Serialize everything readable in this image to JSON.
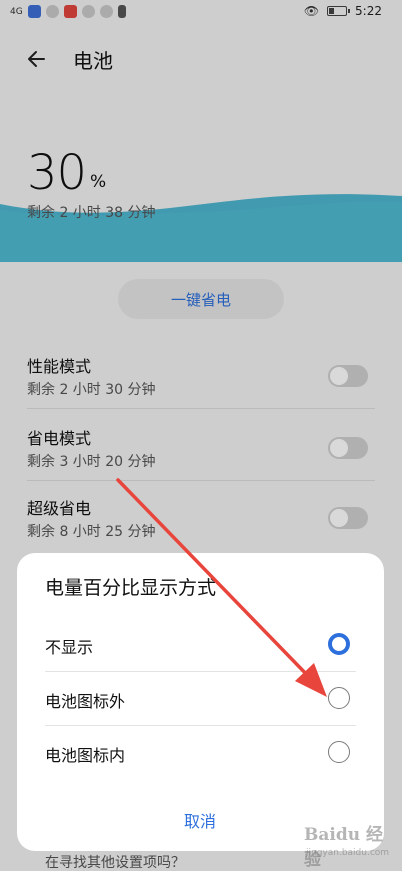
{
  "status_bar": {
    "signal_text": "4G",
    "time": "5:22"
  },
  "header": {
    "title": "电池"
  },
  "battery": {
    "percent": "30",
    "unit": "%",
    "remaining": "剩余 2 小时 38 分钟",
    "wave_color": "#4db6cf"
  },
  "one_key_button": "一键省电",
  "modes": [
    {
      "title": "性能模式",
      "sub": "剩余 2 小时 30 分钟"
    },
    {
      "title": "省电模式",
      "sub": "剩余 3 小时 20 分钟"
    },
    {
      "title": "超级省电",
      "sub": "剩余 8 小时 25 分钟"
    }
  ],
  "peek_text": "在寻找其他设置项吗？",
  "dialog": {
    "title": "电量百分比显示方式",
    "options": [
      {
        "label": "不显示",
        "selected": true
      },
      {
        "label": "电池图标外",
        "selected": false
      },
      {
        "label": "电池图标内",
        "selected": false
      }
    ],
    "cancel": "取消"
  },
  "watermark": {
    "brand": "Baidu 经验",
    "url": "jingyan.baidu.com"
  },
  "colors": {
    "accent": "#2d6fdc",
    "arrow": "#e8453c"
  }
}
